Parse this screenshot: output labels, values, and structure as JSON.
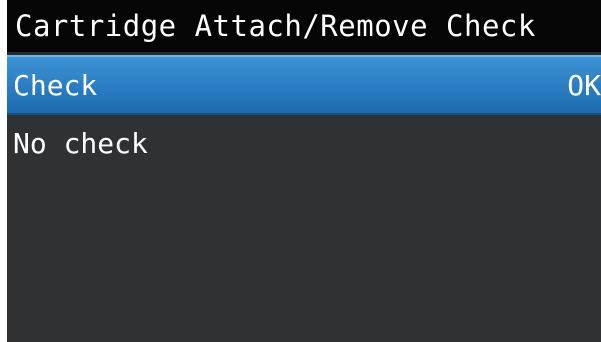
{
  "screen": {
    "title": "Cartridge Attach/Remove Check"
  },
  "menu": {
    "items": [
      {
        "label": "Check",
        "value": "OK",
        "selected": true
      },
      {
        "label": "No check",
        "value": "",
        "selected": false
      }
    ]
  },
  "colors": {
    "title_bar_bg": "#050505",
    "screen_bg": "#2f3235",
    "selection_bg": "#2a7cc2",
    "text": "#ffffff"
  }
}
